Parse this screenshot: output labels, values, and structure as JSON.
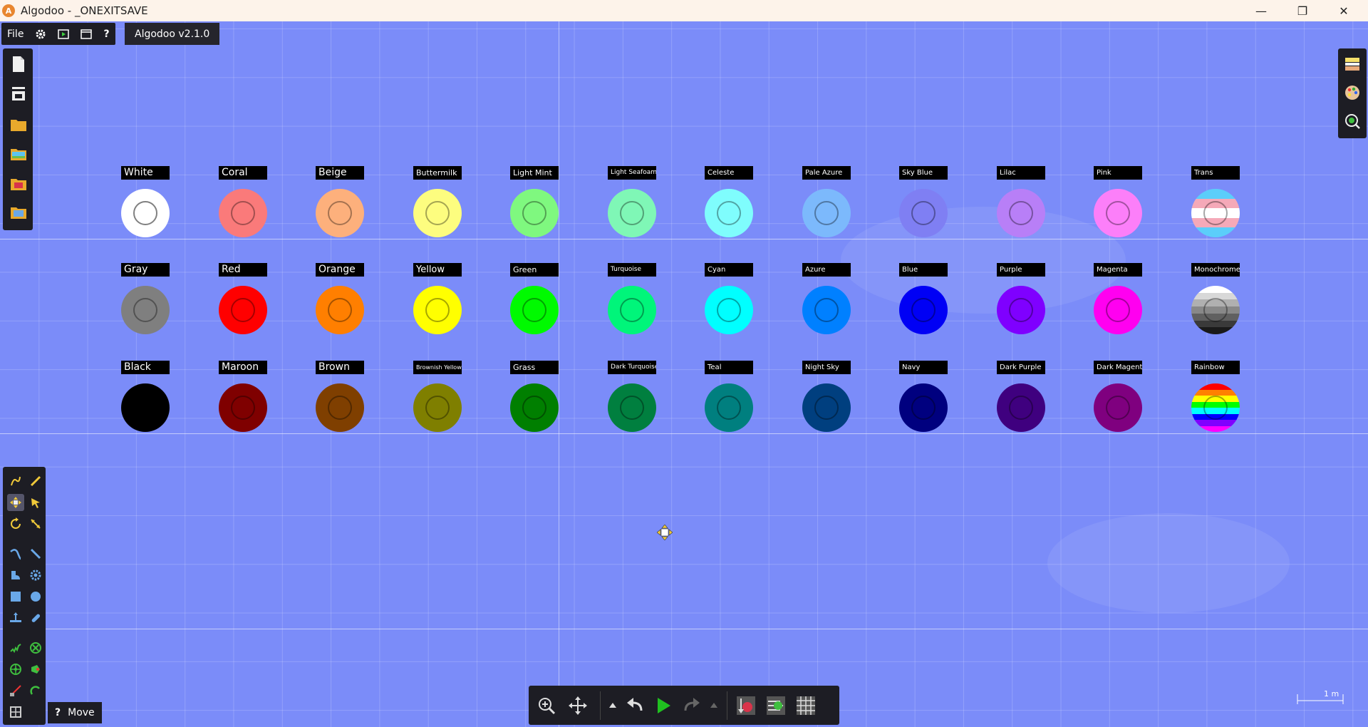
{
  "window": {
    "logo_letter": "A",
    "title": "Algodoo - _ONEXITSAVE",
    "minimize_glyph": "—",
    "maximize_glyph": "❐",
    "close_glyph": "✕"
  },
  "menubar": {
    "file_label": "File",
    "settings_icon": "gear-icon",
    "scene_icon": "play-scene-icon",
    "window_icon": "window-icon",
    "help_label": "?",
    "version": "Algodoo v2.1.0"
  },
  "colors": {
    "background": "#7b8cf9",
    "panel": "#1d1d24"
  },
  "swatch_rows": [
    [
      {
        "name": "White",
        "color": "#ffffff",
        "ring": "#808080",
        "font": 14
      },
      {
        "name": "Coral",
        "color": "#fa7a7a",
        "font": 14
      },
      {
        "name": "Beige",
        "color": "#fdb07c",
        "font": 14
      },
      {
        "name": "Buttermilk",
        "color": "#fdfd7f",
        "font": 11
      },
      {
        "name": "Light Mint",
        "color": "#7ff87f",
        "font": 11
      },
      {
        "name": "Light Seafoam",
        "color": "#7ff7b6",
        "font": 9
      },
      {
        "name": "Celeste",
        "color": "#7ffdfd",
        "font": 10
      },
      {
        "name": "Pale Azure",
        "color": "#7cb9fc",
        "font": 10
      },
      {
        "name": "Sky Blue",
        "color": "#7f7ff3",
        "font": 10
      },
      {
        "name": "Lilac",
        "color": "#b87ff7",
        "font": 10
      },
      {
        "name": "Pink",
        "color": "#fc7ff9",
        "font": 10
      },
      {
        "name": "Trans",
        "pattern": "trans",
        "font": 10
      }
    ],
    [
      {
        "name": "Gray",
        "color": "#7f7f7f",
        "font": 14
      },
      {
        "name": "Red",
        "color": "#ff0000",
        "font": 14
      },
      {
        "name": "Orange",
        "color": "#ff7f00",
        "font": 14
      },
      {
        "name": "Yellow",
        "color": "#ffff00",
        "font": 13
      },
      {
        "name": "Green",
        "color": "#00fa00",
        "font": 11
      },
      {
        "name": "Turquoise",
        "color": "#00f57a",
        "font": 9
      },
      {
        "name": "Cyan",
        "color": "#00ffff",
        "font": 10
      },
      {
        "name": "Azure",
        "color": "#0080ff",
        "font": 10
      },
      {
        "name": "Blue",
        "color": "#0000f5",
        "font": 10
      },
      {
        "name": "Purple",
        "color": "#7f00ff",
        "font": 10
      },
      {
        "name": "Magenta",
        "color": "#ff00f0",
        "font": 10
      },
      {
        "name": "Monochrome",
        "pattern": "mono",
        "font": 10
      }
    ],
    [
      {
        "name": "Black",
        "color": "#000000",
        "font": 14
      },
      {
        "name": "Maroon",
        "color": "#7f0000",
        "font": 14
      },
      {
        "name": "Brown",
        "color": "#7f3f00",
        "font": 14
      },
      {
        "name": "Brownish Yellow",
        "color": "#7f7f00",
        "font": 8
      },
      {
        "name": "Grass",
        "color": "#007f00",
        "font": 11
      },
      {
        "name": "Dark Turquoise",
        "color": "#007f3f",
        "font": 9
      },
      {
        "name": "Teal",
        "color": "#007f7f",
        "font": 10
      },
      {
        "name": "Night Sky",
        "color": "#003f7f",
        "font": 10
      },
      {
        "name": "Navy",
        "color": "#00007f",
        "font": 10
      },
      {
        "name": "Dark Purple",
        "color": "#3f007f",
        "font": 10
      },
      {
        "name": "Dark Magenta",
        "color": "#7f007f",
        "font": 10
      },
      {
        "name": "Rainbow",
        "pattern": "rainbow",
        "font": 10
      }
    ]
  ],
  "move_hint": {
    "q": "?",
    "label": "Move"
  },
  "scale_label": "1 m"
}
